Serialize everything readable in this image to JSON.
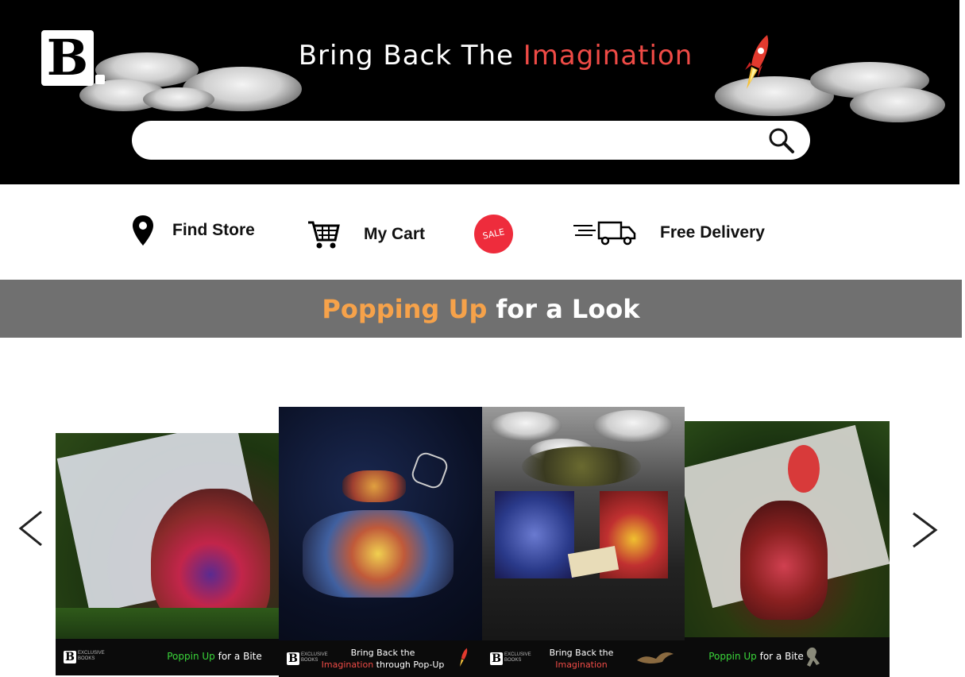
{
  "header": {
    "logo_letter": "B",
    "tagline_main": "Bring Back The",
    "tagline_highlight": "Imagination",
    "search": {
      "placeholder": "",
      "value": ""
    }
  },
  "nav": {
    "find_store": "Find Store",
    "my_cart": "My Cart",
    "sale_badge": "SALE",
    "free_delivery": "Free Delivery"
  },
  "banner": {
    "highlight": "Popping Up",
    "rest": "for a Look"
  },
  "carousel": {
    "prev_arrow": "<",
    "next_arrow": ">",
    "cards": [
      {
        "logo": "B",
        "brand_small": "EXCLUSIVE BOOKS",
        "caption_highlight": "Poppin Up",
        "caption_rest": "for a Bite"
      },
      {
        "logo": "B",
        "brand_small": "EXCLUSIVE BOOKS",
        "line1": "Bring Back the",
        "line2_highlight": "Imagination",
        "line2_rest": "through Pop-Up"
      },
      {
        "logo": "B",
        "brand_small": "EXCLUSIVE BOOKS",
        "line1": "Bring Back the",
        "line2_highlight": "Imagination"
      },
      {
        "caption_highlight": "Poppin Up",
        "caption_rest": "for a Bite"
      }
    ]
  },
  "colors": {
    "accent_red": "#ef4b46",
    "banner_orange": "#f6a24a",
    "banner_gray": "#707070",
    "sale_red": "#ee2c3c",
    "caption_green": "#3ad63a"
  }
}
